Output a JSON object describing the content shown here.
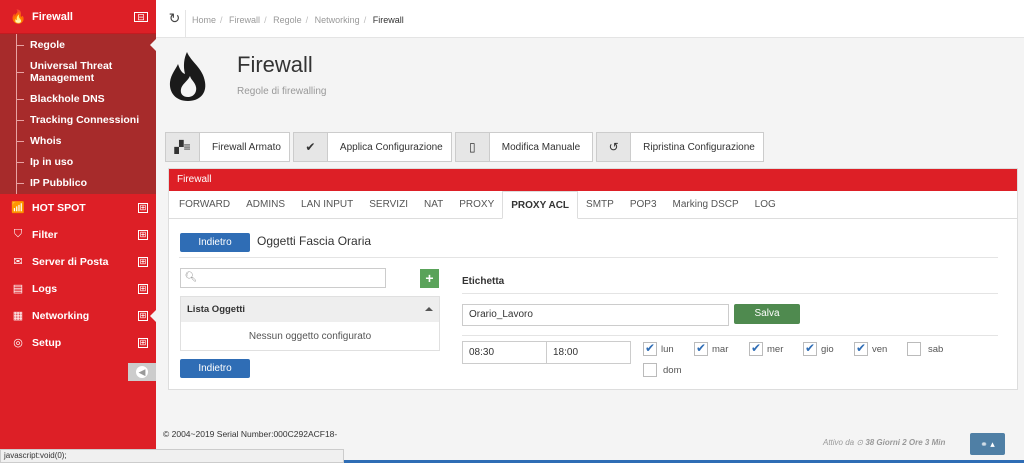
{
  "sidebar": {
    "firewall": {
      "label": "Firewall",
      "icon": "flame-icon",
      "toggle": "⊟"
    },
    "sub_items": [
      {
        "label": "Regole",
        "active": true
      },
      {
        "label": "Universal Threat Management"
      },
      {
        "label": "Blackhole DNS"
      },
      {
        "label": "Tracking Connessioni"
      },
      {
        "label": "Whois"
      },
      {
        "label": "Ip in uso"
      },
      {
        "label": "IP Pubblico"
      }
    ],
    "sections": [
      {
        "label": "HOT SPOT",
        "icon": "wifi-icon",
        "toggle": "⊞"
      },
      {
        "label": "Filter",
        "icon": "shield-icon",
        "toggle": "⊞"
      },
      {
        "label": "Server di Posta",
        "icon": "mail-icon",
        "toggle": "⊞"
      },
      {
        "label": "Logs",
        "icon": "logs-icon",
        "toggle": "⊞"
      },
      {
        "label": "Networking",
        "icon": "network-icon",
        "toggle": "⊞"
      },
      {
        "label": "Setup",
        "icon": "setup-icon",
        "toggle": "⊞"
      }
    ]
  },
  "breadcrumb": [
    "Home",
    "Firewall",
    "Regole",
    "Networking",
    "Firewall"
  ],
  "header": {
    "title": "Firewall",
    "subtitle": "Regole di firewalling"
  },
  "actions": [
    {
      "label": "Firewall Armato",
      "icon": "firewall-armed-icon"
    },
    {
      "label": "Applica Configurazione",
      "icon": "check-icon"
    },
    {
      "label": "Modifica Manuale",
      "icon": "document-icon"
    },
    {
      "label": "Ripristina Configurazione",
      "icon": "restore-icon"
    }
  ],
  "panel": {
    "title": "Firewall",
    "tabs": [
      "FORWARD",
      "ADMINS",
      "LAN INPUT",
      "SERVIZI",
      "NAT",
      "PROXY",
      "PROXY ACL",
      "SMTP",
      "POP3",
      "Marking DSCP",
      "LOG"
    ],
    "active_tab": "PROXY ACL",
    "back_label": "Indietro",
    "section_title": "Oggetti Fascia Oraria",
    "search_placeholder": "",
    "add_label": "+",
    "list_header": "Lista Oggetti",
    "list_empty": "Nessun oggetto configurato",
    "back_label_2": "Indietro",
    "label_title": "Etichetta",
    "name_value": "Orario_Lavoro",
    "save_label": "Salva",
    "time_from": "08:30",
    "time_to": "18:00",
    "days": [
      {
        "label": "lun",
        "checked": true
      },
      {
        "label": "mar",
        "checked": true
      },
      {
        "label": "mer",
        "checked": true
      },
      {
        "label": "gio",
        "checked": true
      },
      {
        "label": "ven",
        "checked": true
      },
      {
        "label": "sab",
        "checked": false
      },
      {
        "label": "dom",
        "checked": false
      }
    ]
  },
  "footer": {
    "copyright": "© 2004~2019  Serial Number:000C292ACF18-",
    "active_label": "Attivo da",
    "active_value": "38 Giorni 2 Ore 3 Min"
  },
  "statusbar": "javascript:void(0);",
  "colors": {
    "brand_red": "#dd1f26",
    "sub_red": "#a72b2b",
    "primary_blue": "#2f6db5",
    "success_green": "#4f8a4f"
  }
}
